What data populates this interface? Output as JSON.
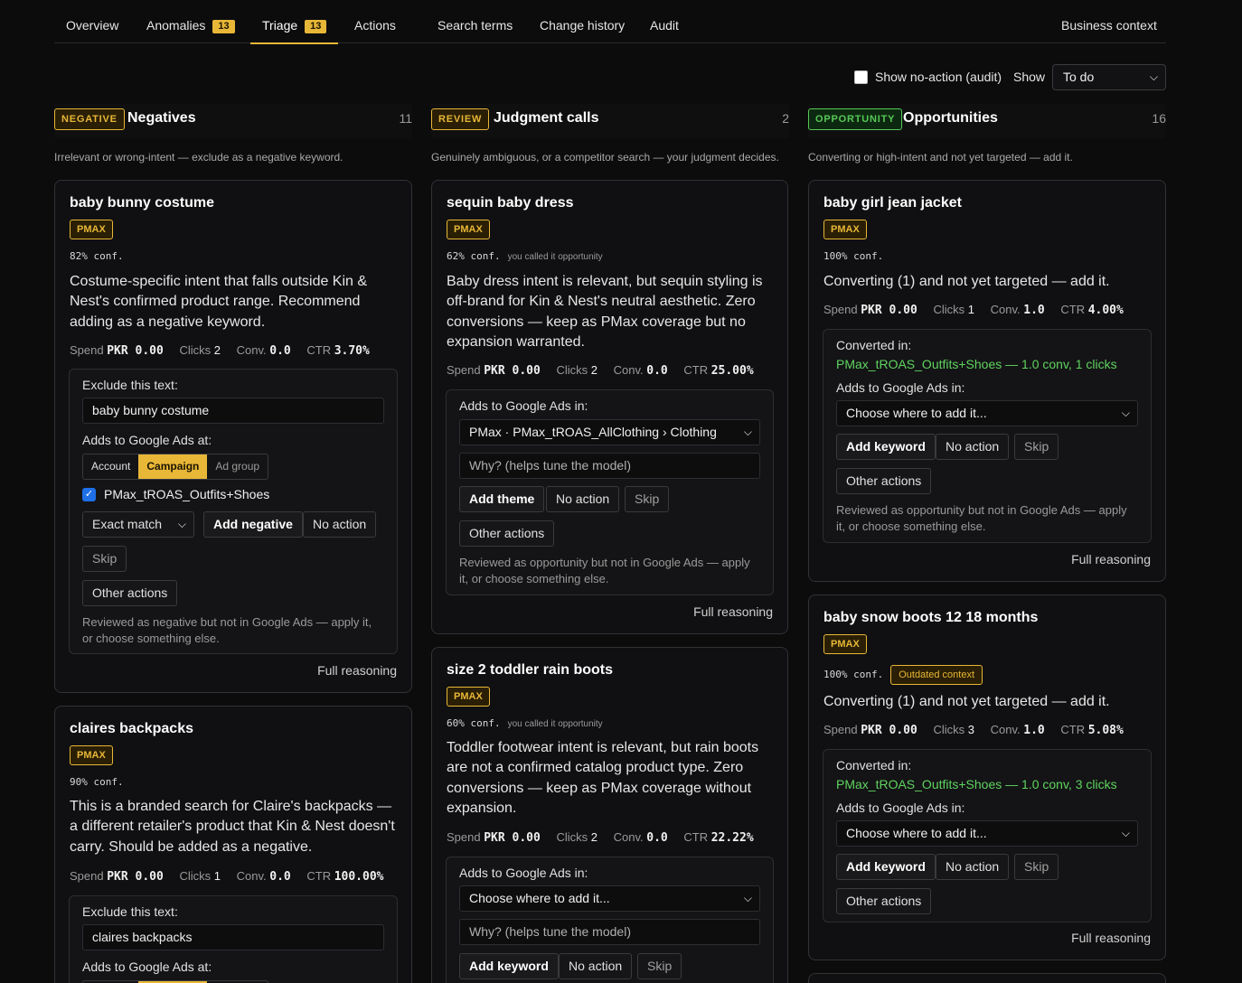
{
  "tabs": [
    {
      "label": "Overview"
    },
    {
      "label": "Anomalies",
      "badge": "13"
    },
    {
      "label": "Triage",
      "badge": "13"
    },
    {
      "label": "Actions"
    },
    {
      "label": "Search terms"
    },
    {
      "label": "Change history"
    },
    {
      "label": "Audit"
    },
    {
      "label": "Business context"
    }
  ],
  "filters": {
    "show_no_action_label": "Show no-action (audit)",
    "show_label": "Show",
    "show_value": "To do"
  },
  "columns": {
    "negatives": {
      "pill": "NEGATIVE",
      "title": "Negatives",
      "count": "11",
      "desc": "Irrelevant or wrong-intent — exclude as a negative keyword."
    },
    "review": {
      "pill": "REVIEW",
      "title": "Judgment calls",
      "count": "2",
      "desc": "Genuinely ambiguous, or a competitor search — your judgment decides."
    },
    "opportunity": {
      "pill": "OPPORTUNITY",
      "title": "Opportunities",
      "count": "16",
      "desc": "Converting or high-intent and not yet targeted — add it."
    }
  },
  "common": {
    "tag": "PMAX",
    "spend_label": "Spend",
    "clicks_label": "Clicks",
    "conv_label": "Conv.",
    "ctr_label": "CTR",
    "exclude_label": "Exclude this text:",
    "adds_at_label": "Adds to Google Ads at:",
    "adds_in_label": "Adds to Google Ads in:",
    "converted_in_label": "Converted in:",
    "seg_account": "Account",
    "seg_campaign": "Campaign",
    "seg_adgroup": "Ad group",
    "match_type": "Exact match",
    "add_negative": "Add negative",
    "add_theme": "Add theme",
    "add_keyword": "Add keyword",
    "no_action": "No action",
    "skip": "Skip",
    "other_actions": "Other actions",
    "why_placeholder": "Why? (helps tune the model)",
    "choose_where": "Choose where to add it...",
    "full_reasoning": "Full reasoning",
    "hint_negative": "Reviewed as negative but not in Google Ads — apply it, or choose something else.",
    "hint_opportunity": "Reviewed as opportunity but not in Google Ads — apply it, or choose something else.",
    "you_called": "you called it opportunity",
    "outdated": "Outdated context"
  },
  "cards": {
    "n1": {
      "title": "baby bunny costume",
      "conf": "82% conf.",
      "reason": "Costume-specific intent that falls outside Kin & Nest's confirmed product range. Recommend adding as a negative keyword.",
      "spend": "PKR 0.00",
      "clicks": "2",
      "conv": "0.0",
      "ctr": "3.70%",
      "exclude": "baby bunny costume",
      "campaign": "PMax_tROAS_Outfits+Shoes"
    },
    "n2": {
      "title": "claires backpacks",
      "conf": "90% conf.",
      "reason": "This is a branded search for Claire's backpacks — a different retailer's product that Kin & Nest doesn't carry. Should be added as a negative.",
      "spend": "PKR 0.00",
      "clicks": "1",
      "conv": "0.0",
      "ctr": "100.00%",
      "exclude": "claires backpacks"
    },
    "r1": {
      "title": "sequin baby dress",
      "conf": "62% conf.",
      "reason": "Baby dress intent is relevant, but sequin styling is off-brand for Kin & Nest's neutral aesthetic. Zero conversions — keep as PMax coverage but no expansion warranted.",
      "spend": "PKR 0.00",
      "clicks": "2",
      "conv": "0.0",
      "ctr": "25.00%",
      "target": "PMax · PMax_tROAS_AllClothing › Clothing"
    },
    "r2": {
      "title": "size 2 toddler rain boots",
      "conf": "60% conf.",
      "reason": "Toddler footwear intent is relevant, but rain boots are not a confirmed catalog product type. Zero conversions — keep as PMax coverage without expansion.",
      "spend": "PKR 0.00",
      "clicks": "2",
      "conv": "0.0",
      "ctr": "22.22%"
    },
    "o1": {
      "title": "baby girl jean jacket",
      "conf": "100% conf.",
      "reason": "Converting (1) and not yet targeted — add it.",
      "spend": "PKR 0.00",
      "clicks": "1",
      "conv": "1.0",
      "ctr": "4.00%",
      "converted": "PMax_tROAS_Outfits+Shoes — 1.0 conv, 1 clicks"
    },
    "o2": {
      "title": "baby snow boots 12 18 months",
      "conf": "100% conf.",
      "reason": "Converting (1) and not yet targeted — add it.",
      "spend": "PKR 0.00",
      "clicks": "3",
      "conv": "1.0",
      "ctr": "5.08%",
      "converted": "PMax_tROAS_Outfits+Shoes — 1.0 conv, 3 clicks"
    }
  },
  "colors": {
    "accent": "#e8b737",
    "opportunity": "#56c856",
    "background": "#0c0c0d",
    "checkbox": "#1e6fe8"
  },
  "icons": [
    "chevron-down-icon",
    "checkmark-icon"
  ]
}
